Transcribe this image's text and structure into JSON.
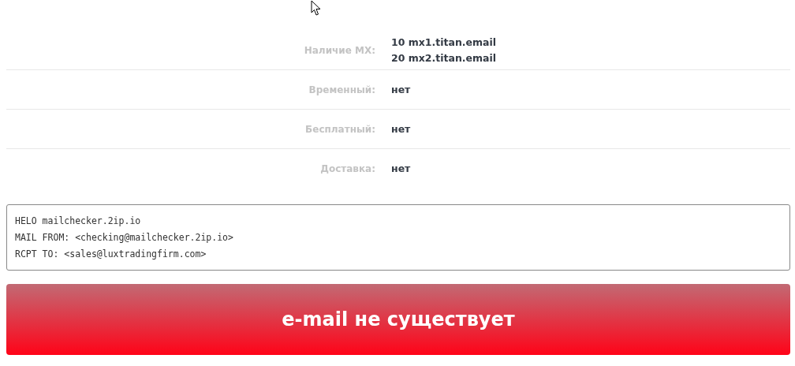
{
  "details": [
    {
      "label": "Наличие MX:",
      "values": [
        "**10** mx1.titan.email",
        "**20** mx2.titan.email"
      ]
    },
    {
      "label": "Временный:",
      "values": [
        "нет"
      ]
    },
    {
      "label": "Бесплатный:",
      "values": [
        "нет"
      ]
    },
    {
      "label": "Доставка:",
      "values": [
        "нет"
      ]
    }
  ],
  "smtp_log": [
    "HELO mailchecker.2ip.io",
    "MAIL FROM: <checking@mailchecker.2ip.io>",
    "RCPT TO: <sales@luxtradingfirm.com>"
  ],
  "result": {
    "kind": "error",
    "text": "e-mail не существует"
  }
}
